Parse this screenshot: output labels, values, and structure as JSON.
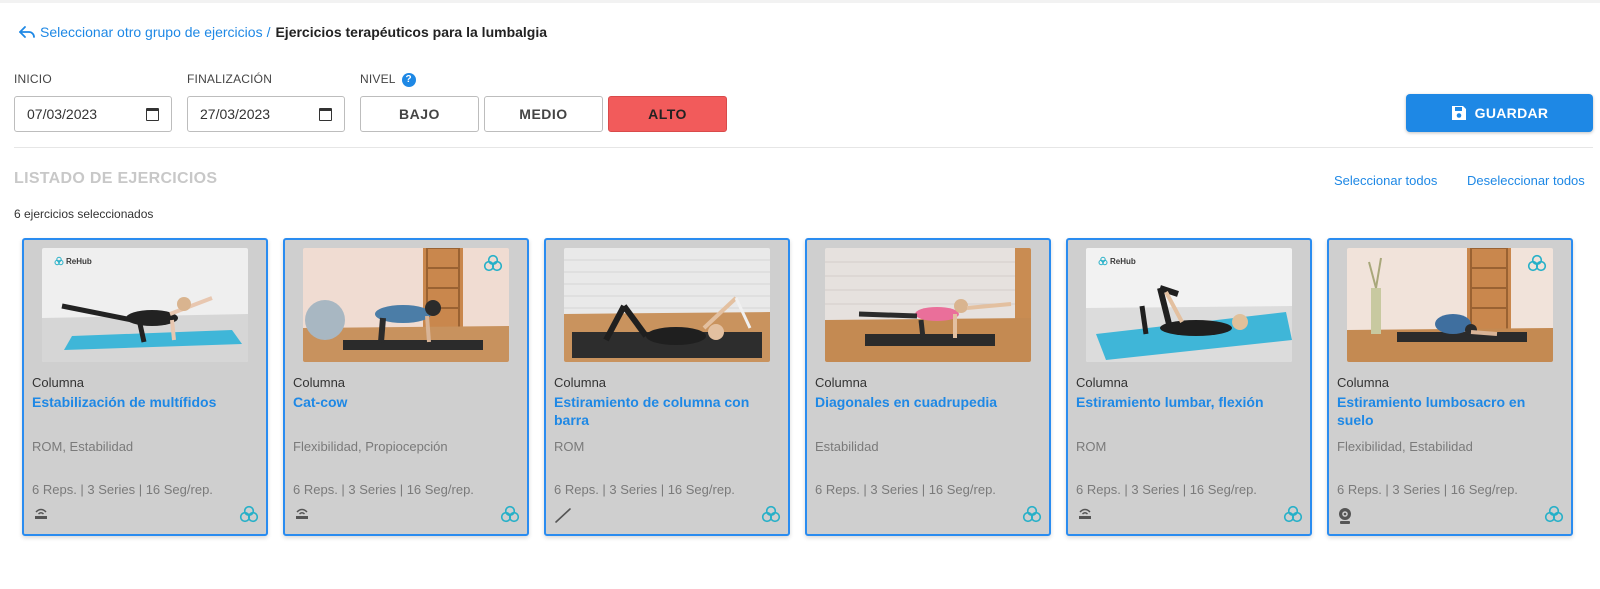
{
  "breadcrumb": {
    "back_label": "Seleccionar otro grupo de ejercicios",
    "separator": "/",
    "current": "Ejercicios terapéuticos para la lumbalgia"
  },
  "form": {
    "start_label": "INICIO",
    "start_value": "07/03/2023",
    "end_label": "FINALIZACIÓN",
    "end_value": "27/03/2023",
    "level_label": "NIVEL",
    "levels": [
      "BAJO",
      "MEDIO",
      "ALTO"
    ],
    "selected_level": "ALTO"
  },
  "toolbar": {
    "save_label": "GUARDAR"
  },
  "list": {
    "title": "LISTADO DE EJERCICIOS",
    "select_all": "Seleccionar todos",
    "deselect_all": "Deseleccionar todos",
    "count_text": "6 ejercicios seleccionados"
  },
  "colors": {
    "accent": "#1e88e5",
    "selected_level": "#f25b5b",
    "teal": "#26b0c8",
    "card_bg": "#cfcfcf"
  },
  "cards": [
    {
      "category": "Columna",
      "name": "Estabilización de multífidos",
      "tags": "ROM, Estabilidad",
      "reps": "6 Reps. | 3 Series | 16 Seg/rep.",
      "logo": "ReHub",
      "bottom_left_icon": "sensor-icon"
    },
    {
      "category": "Columna",
      "name": "Cat-cow",
      "tags": "Flexibilidad, Propiocepción",
      "reps": "6 Reps. | 3 Series | 16 Seg/rep.",
      "logo": "",
      "bottom_left_icon": "sensor-icon"
    },
    {
      "category": "Columna",
      "name": "Estiramiento de columna con barra",
      "tags": "ROM",
      "reps": "6 Reps. | 3 Series | 16 Seg/rep.",
      "logo": "",
      "bottom_left_icon": "bar-icon"
    },
    {
      "category": "Columna",
      "name": "Diagonales en cuadrupedia",
      "tags": "Estabilidad",
      "reps": "6 Reps. | 3 Series | 16 Seg/rep.",
      "logo": "",
      "bottom_left_icon": ""
    },
    {
      "category": "Columna",
      "name": "Estiramiento lumbar, flexión",
      "tags": "ROM",
      "reps": "6 Reps. | 3 Series | 16 Seg/rep.",
      "logo": "ReHub",
      "bottom_left_icon": "sensor-icon"
    },
    {
      "category": "Columna",
      "name": "Estiramiento lumbosacro en suelo",
      "tags": "Flexibilidad, Estabilidad",
      "reps": "6 Reps. | 3 Series | 16 Seg/rep.",
      "logo": "",
      "bottom_left_icon": "webcam-icon"
    }
  ]
}
